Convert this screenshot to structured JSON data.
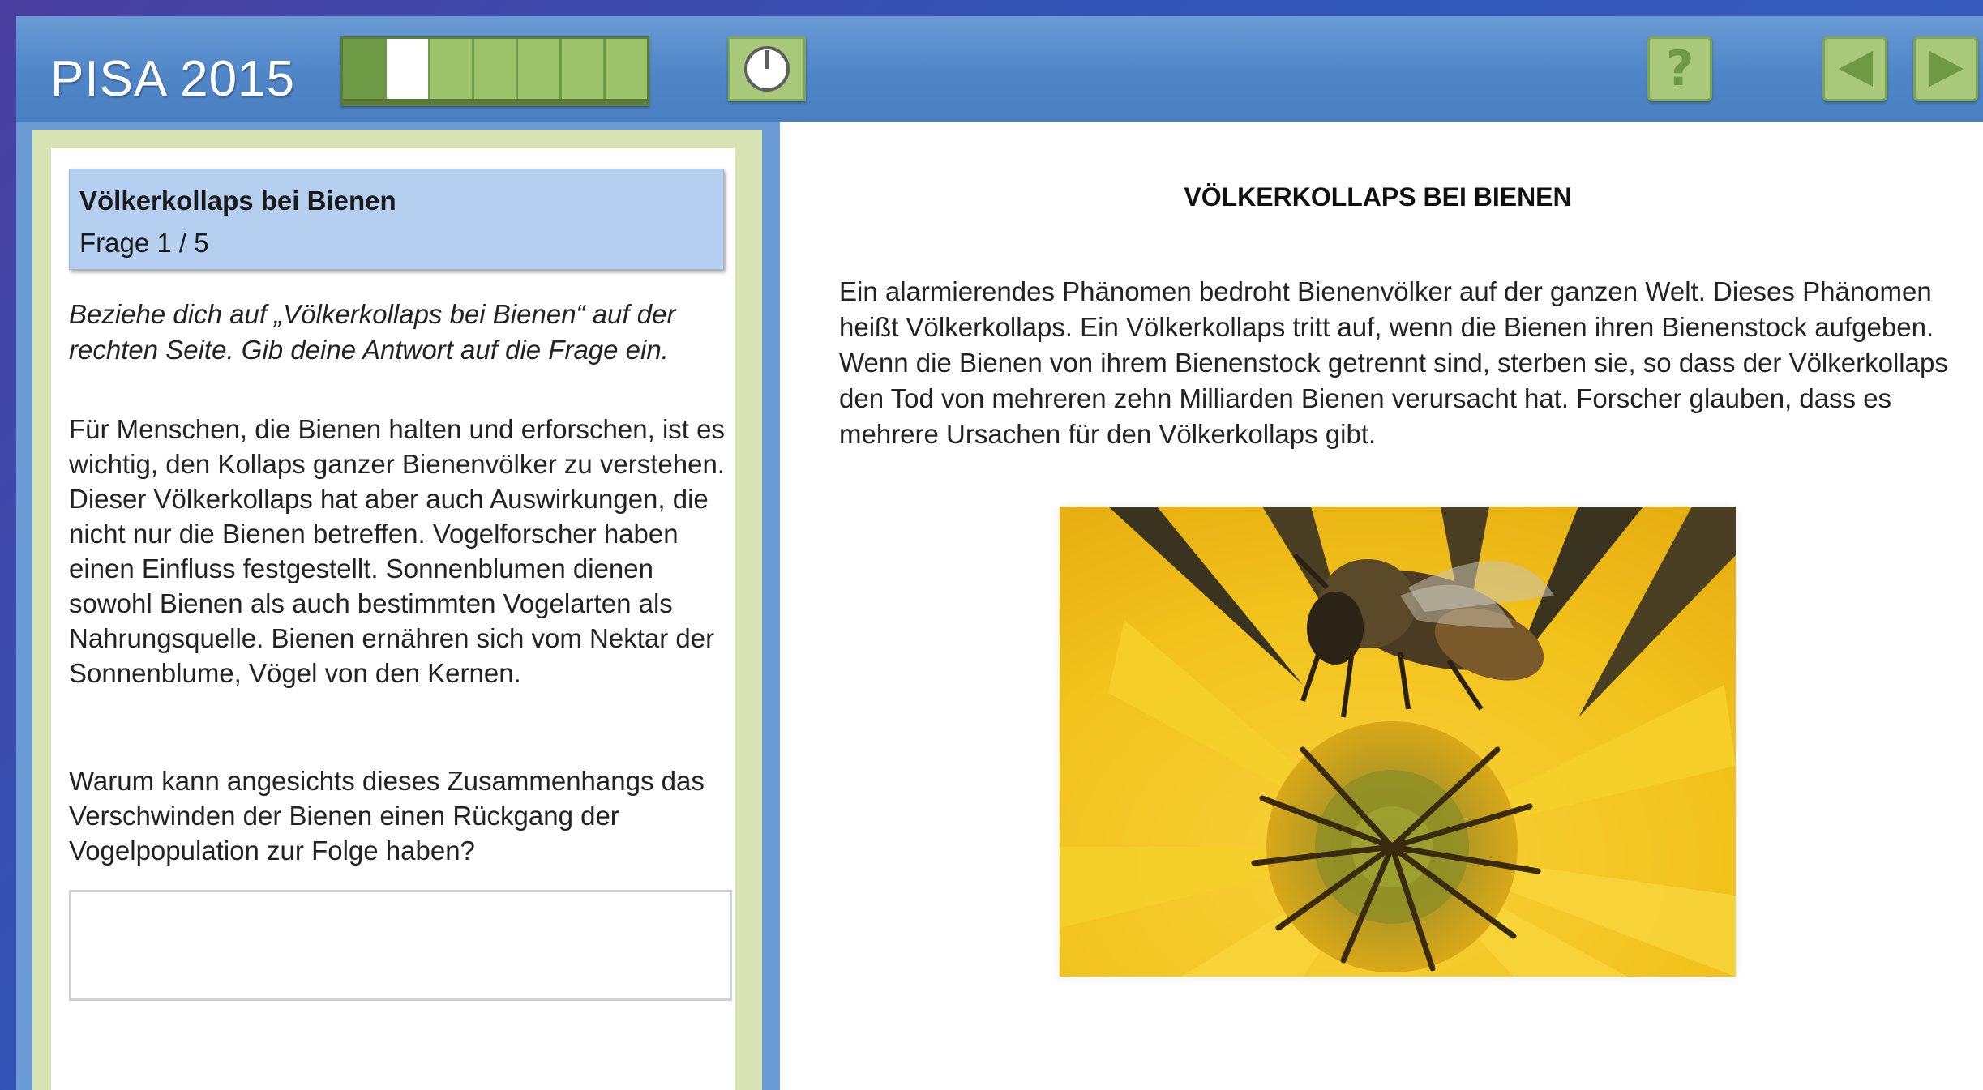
{
  "header": {
    "brand": "PISA 2015",
    "progress": {
      "total_units": 7,
      "completed_units": 1,
      "current_unit": 2
    },
    "timer_icon": "clock-icon",
    "help_icon": "help-icon",
    "help_glyph": "?",
    "back_icon": "triangle-left-icon",
    "next_icon": "triangle-right-icon",
    "colors": {
      "header_blue": "#4f86c8",
      "button_green": "#a8c97a",
      "progress_dark_green": "#6f9a45"
    }
  },
  "question": {
    "title": "Völkerkollaps bei Bienen",
    "counter": "Frage 1 / 5",
    "instruction": "Beziehe dich auf „Völkerkollaps bei Bienen“ auf der rechten Seite. Gib deine Antwort auf die Frage ein.",
    "context": "Für Menschen, die Bienen halten und erforschen, ist es wichtig, den Kollaps ganzer Bienenvölker zu verstehen. Dieser Völkerkollaps hat aber auch Auswirkungen, die nicht nur die Bienen betreffen. Vogelforscher haben einen Einfluss festgestellt. Sonnenblumen dienen sowohl Bienen als auch bestimmten Vogelarten als Nahrungsquelle. Bienen ernähren sich vom Nektar der Sonnenblume, Vögel von den Kernen.",
    "prompt": "Warum kann angesichts dieses Zusammenhangs das Verschwinden der Bienen einen Rückgang der Vogelpopulation zur Folge haben?",
    "answer_value": ""
  },
  "article": {
    "title": "VÖLKERKOLLAPS BEI BIENEN",
    "body": "Ein alarmierendes Phänomen bedroht Bienenvölker auf der ganzen Welt. Dieses Phänomen heißt Völkerkollaps. Ein Völkerkollaps tritt auf, wenn die Bienen ihren Bienenstock aufgeben. Wenn die Bienen von ihrem Bienenstock getrennt sind, sterben sie, so dass der Völkerkollaps den Tod von mehreren zehn Milliarden Bienen verursacht hat. Forscher glauben, dass es mehrere Ursachen für den Völkerkollaps gibt."
  }
}
